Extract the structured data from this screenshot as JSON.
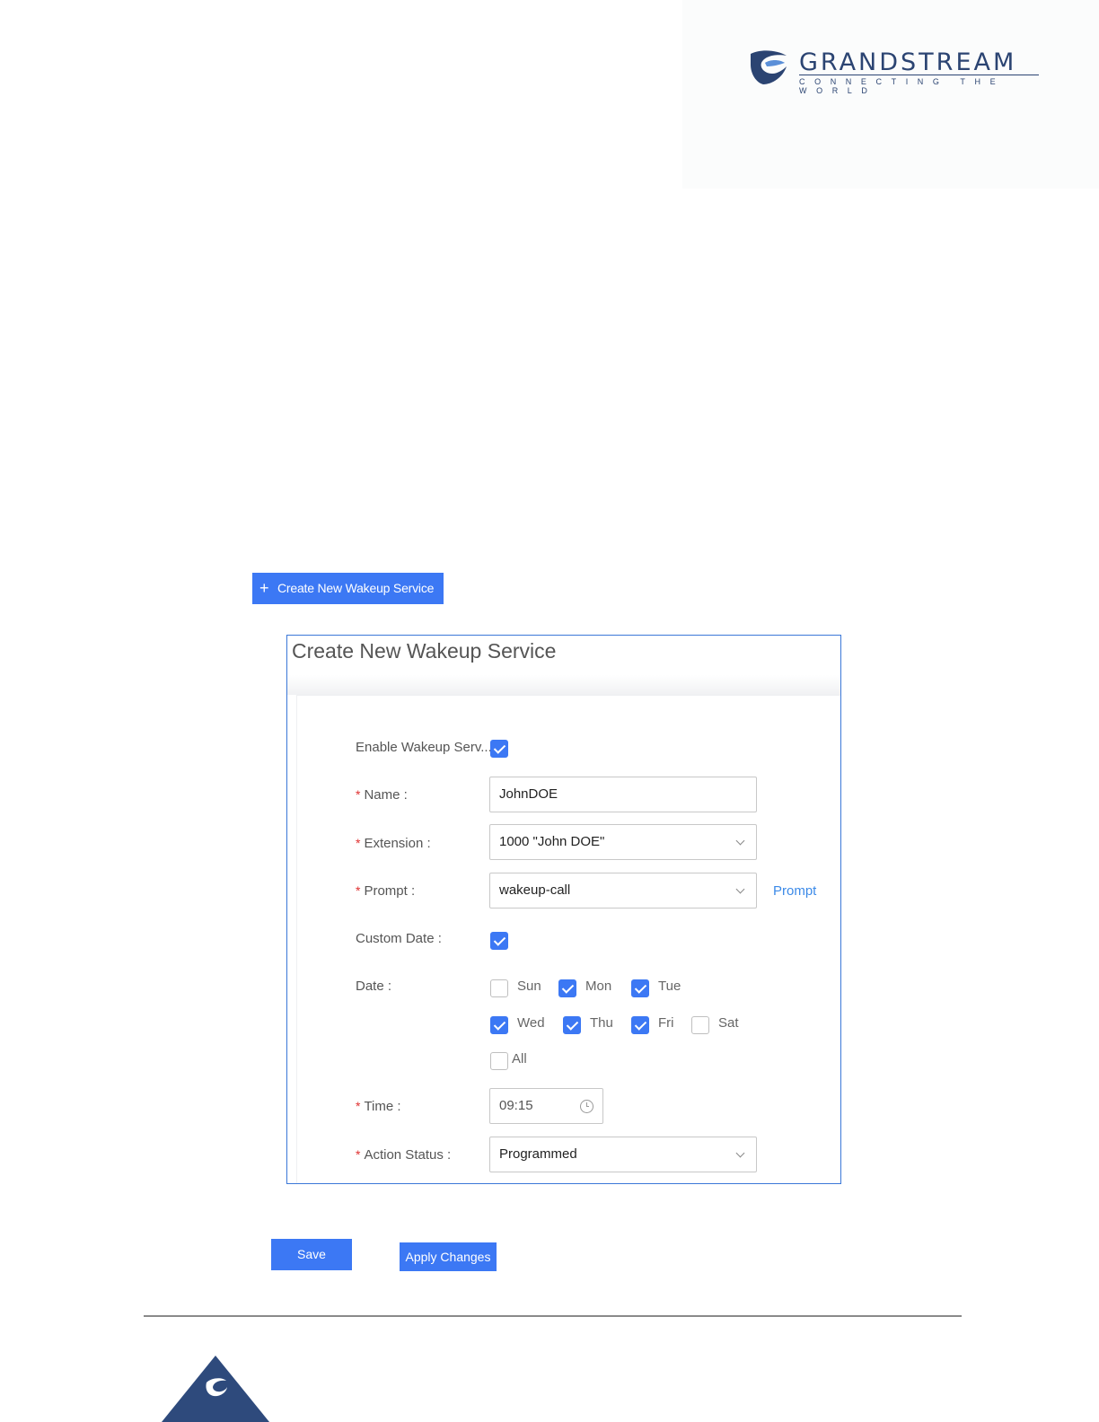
{
  "brand": {
    "name": "GRANDSTREAM",
    "tagline": "CONNECTING THE WORLD",
    "color": "#2b4472"
  },
  "toolbar": {
    "create_label": "Create New Wakeup Service",
    "accent": "#3c78f4"
  },
  "dialog": {
    "title": "Create New Wakeup Service",
    "fields": {
      "enable": {
        "label": "Enable Wakeup Serv...",
        "checked": true
      },
      "name": {
        "label": "Name :",
        "value": "JohnDOE",
        "required": true
      },
      "extension": {
        "label": "Extension :",
        "value": "1000 \"John DOE\"",
        "required": true
      },
      "prompt": {
        "label": "Prompt :",
        "value": "wakeup-call",
        "link": "Prompt",
        "required": true
      },
      "custom_date": {
        "label": "Custom Date :",
        "checked": true
      },
      "date": {
        "label": "Date :",
        "days": [
          {
            "label": "Sun",
            "checked": false
          },
          {
            "label": "Mon",
            "checked": true
          },
          {
            "label": "Tue",
            "checked": true
          },
          {
            "label": "Wed",
            "checked": true
          },
          {
            "label": "Thu",
            "checked": true
          },
          {
            "label": "Fri",
            "checked": true
          },
          {
            "label": "Sat",
            "checked": false
          },
          {
            "label": "All",
            "checked": false
          }
        ]
      },
      "time": {
        "label": "Time :",
        "value": "09:15",
        "required": true
      },
      "action_status": {
        "label": "Action Status :",
        "value": "Programmed",
        "required": true
      }
    }
  },
  "actions": {
    "save_label": "Save",
    "apply_label": "Apply Changes"
  },
  "required_mark": "*"
}
